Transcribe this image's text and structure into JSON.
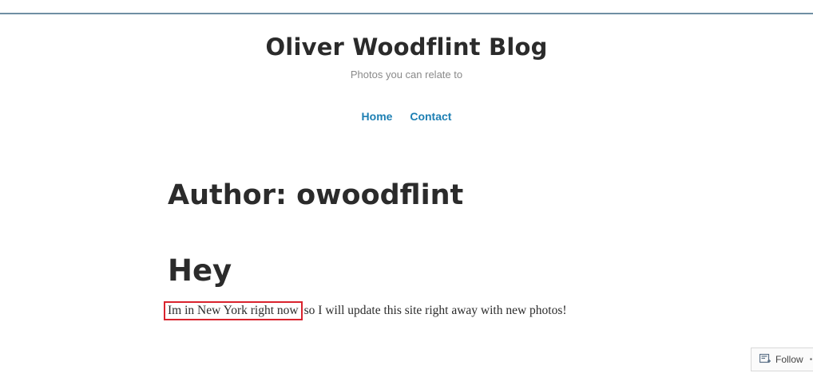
{
  "site": {
    "title": "Oliver Woodflint Blog",
    "tagline": "Photos you can relate to"
  },
  "nav": {
    "items": [
      {
        "label": "Home"
      },
      {
        "label": "Contact"
      }
    ]
  },
  "archive": {
    "title": "Author: owoodflint"
  },
  "post": {
    "title": "Hey",
    "highlighted_text": "Im in New York right now",
    "rest_text": "so I will update this site right away with new photos!"
  },
  "follow_widget": {
    "label": "Follow",
    "icon": "follow-reader-icon",
    "more_icon": "ellipsis-icon"
  },
  "colors": {
    "link": "#1d7fb3",
    "title": "#2b2b2b",
    "tagline": "#8a8a8a",
    "highlight_border": "#d9232d",
    "top_rule": "#6f8fa3"
  }
}
